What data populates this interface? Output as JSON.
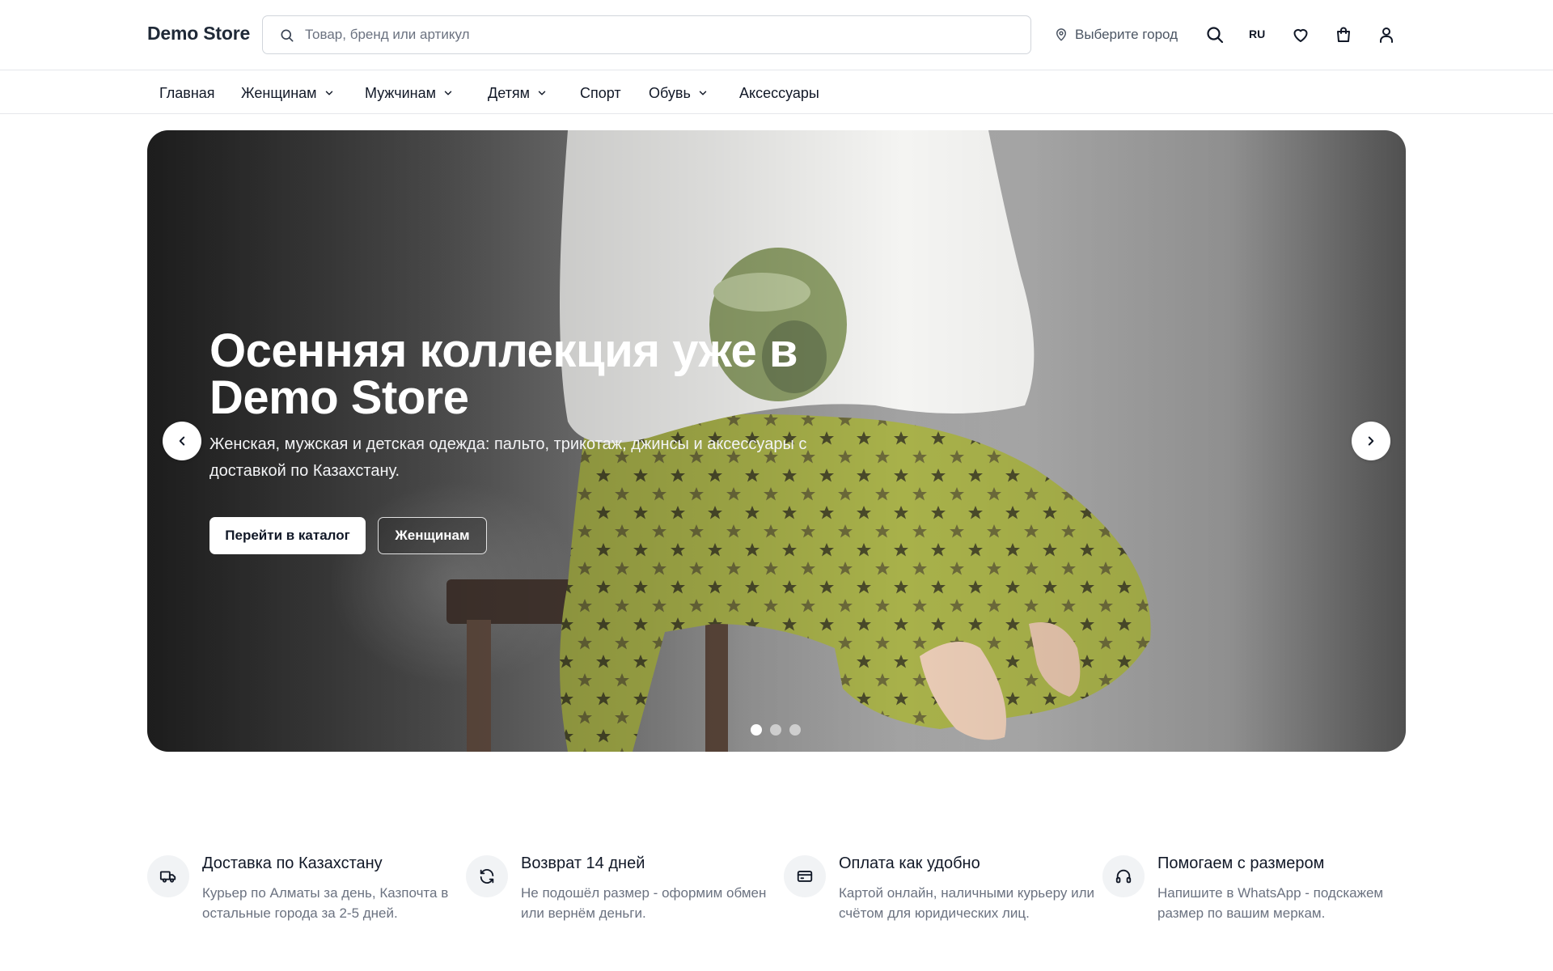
{
  "header": {
    "logo": "Demo Store",
    "search_placeholder": "Товар, бренд или артикул",
    "search_value": "",
    "city_label": "Выберите город",
    "lang": "RU",
    "icons": [
      "map-pin-icon",
      "search-icon",
      "heart-icon",
      "shopping-bag-icon",
      "user-icon"
    ]
  },
  "nav": {
    "items": [
      {
        "label": "Главная",
        "has_dropdown": false
      },
      {
        "label": "Женщинам",
        "has_dropdown": true
      },
      {
        "label": "Мужчинам",
        "has_dropdown": true
      },
      {
        "label": "Детям",
        "has_dropdown": true
      },
      {
        "label": "Спорт",
        "has_dropdown": false
      },
      {
        "label": "Обувь",
        "has_dropdown": true
      },
      {
        "label": "Аксессуары",
        "has_dropdown": false
      }
    ]
  },
  "hero": {
    "title": "Осенняя коллекция уже в Demo Store",
    "subtitle": "Женская, мужская и детская одежда: пальто, трикотаж, джинсы и аксессуары с доставкой по Казахстану.",
    "primary_button": "Перейти в каталог",
    "secondary_button": "Женщинам",
    "slides_count": 3,
    "active_slide": 1
  },
  "features": [
    {
      "icon": "truck-icon",
      "title": "Доставка по Казахстану",
      "text": "Курьер по Алматы за день, Казпочта в остальные города за 2-5 дней."
    },
    {
      "icon": "refresh-icon",
      "title": "Возврат 14 дней",
      "text": "Не подошёл размер - оформим обмен или вернём деньги."
    },
    {
      "icon": "credit-card-icon",
      "title": "Оплата как удобно",
      "text": "Картой онлайн, наличными курьеру или счётом для юридических лиц."
    },
    {
      "icon": "headphones-icon",
      "title": "Помогаем с размером",
      "text": "Напишите в WhatsApp - подскажем размер по вашим меркам."
    }
  ],
  "colors": {
    "text": "#111827",
    "muted": "#6b7280",
    "border": "#e5e7eb",
    "icon_bg": "#f1f3f5"
  }
}
